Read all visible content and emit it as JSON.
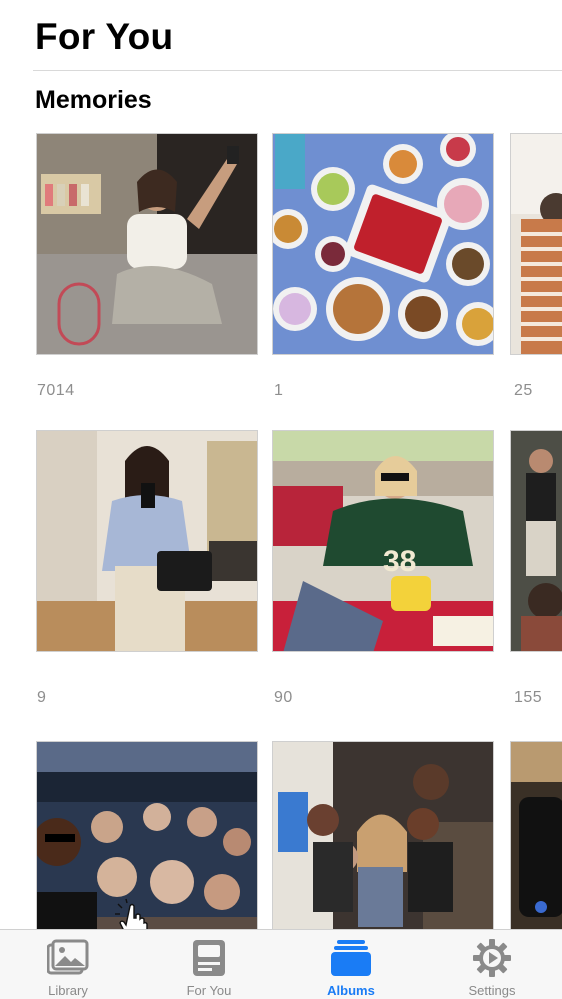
{
  "header": {
    "title": "For You"
  },
  "memories": {
    "section_title": "Memories",
    "rows": [
      {
        "counts": [
          "7014",
          "1",
          "25"
        ]
      },
      {
        "counts": [
          "9",
          "90",
          "155"
        ]
      },
      {
        "counts": [
          "",
          "",
          ""
        ]
      }
    ]
  },
  "tabbar": {
    "tabs": [
      {
        "label": "Library",
        "icon": "library-photos-icon",
        "active": false
      },
      {
        "label": "For You",
        "icon": "for-you-card-icon",
        "active": false
      },
      {
        "label": "Albums",
        "icon": "albums-folder-icon",
        "active": true
      },
      {
        "label": "Settings",
        "icon": "settings-gear-icon",
        "active": false
      }
    ]
  },
  "colors": {
    "accent": "#1a7cf5",
    "inactive": "#8a8a8a",
    "count_text": "#8e8e8e"
  }
}
